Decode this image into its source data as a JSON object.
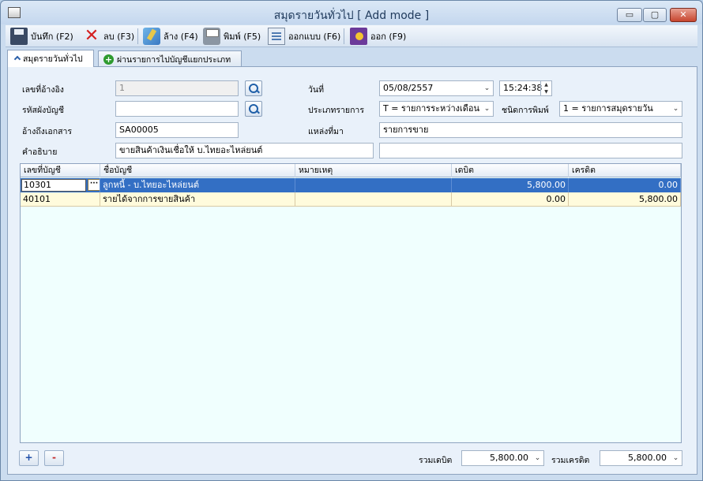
{
  "window": {
    "title": "สมุดรายวันทั่วไป [ Add mode ]",
    "minimize": "▭",
    "maximize": "▢",
    "close": "✕"
  },
  "toolbar": {
    "save_label": "บันทึก (F2)",
    "delete_label": "ลบ (F3)",
    "clear_label": "ล้าง (F4)",
    "print_label": "พิมพ์ (F5)",
    "design_label": "ออกแบบ (F6)",
    "exit_label": "ออก (F9)"
  },
  "tabs": [
    {
      "label": "สมุดรายวันทั่วไป"
    },
    {
      "label": "ผ่านรายการไปบัญชีแยกประเภท"
    }
  ],
  "form": {
    "ref_no_label": "เลขที่อ้างอิง",
    "ref_no_value": "1",
    "account_chart_label": "รหัสผังบัญชี",
    "account_chart_value": "",
    "doc_ref_label": "อ้างถึงเอกสาร",
    "doc_ref_value": "SA00005",
    "description_label": "คำอธิบาย",
    "description_value": "ขายสินค้าเงินเชื่อให้ บ.ไทยอะไหล่ยนต์",
    "description_extra_value": "",
    "date_label": "วันที่",
    "date_value": "05/08/2557",
    "time_value": "15:24:38",
    "type_label": "ประเภทรายการ",
    "type_value": "T = รายการระหว่างเดือน",
    "print_type_label": "ชนิดการพิมพ์",
    "print_type_value": "1 = รายการสมุดรายวัน",
    "source_label": "แหล่งที่มา",
    "source_value": "รายการขาย"
  },
  "grid": {
    "columns": [
      "เลขที่บัญชี",
      "ชื่อบัญชี",
      "หมายเหตุ",
      "เดบิต",
      "เครดิต"
    ],
    "rows": [
      {
        "account_no": "10301",
        "account_name": "ลูกหนี้ - บ.ไทยอะไหล่ยนต์",
        "note": "",
        "debit": "5,800.00",
        "credit": "0.00"
      },
      {
        "account_no": "40101",
        "account_name": "รายได้จากการขายสินค้า",
        "note": "",
        "debit": "0.00",
        "credit": "5,800.00"
      }
    ],
    "ellipsis": "···"
  },
  "footer": {
    "add_label": "+",
    "remove_label": "-",
    "total_debit_label": "รวมเดบิต",
    "total_debit_value": "5,800.00",
    "total_credit_label": "รวมเครดิต",
    "total_credit_value": "5,800.00"
  },
  "icons": {
    "dropdown": "⌄"
  }
}
